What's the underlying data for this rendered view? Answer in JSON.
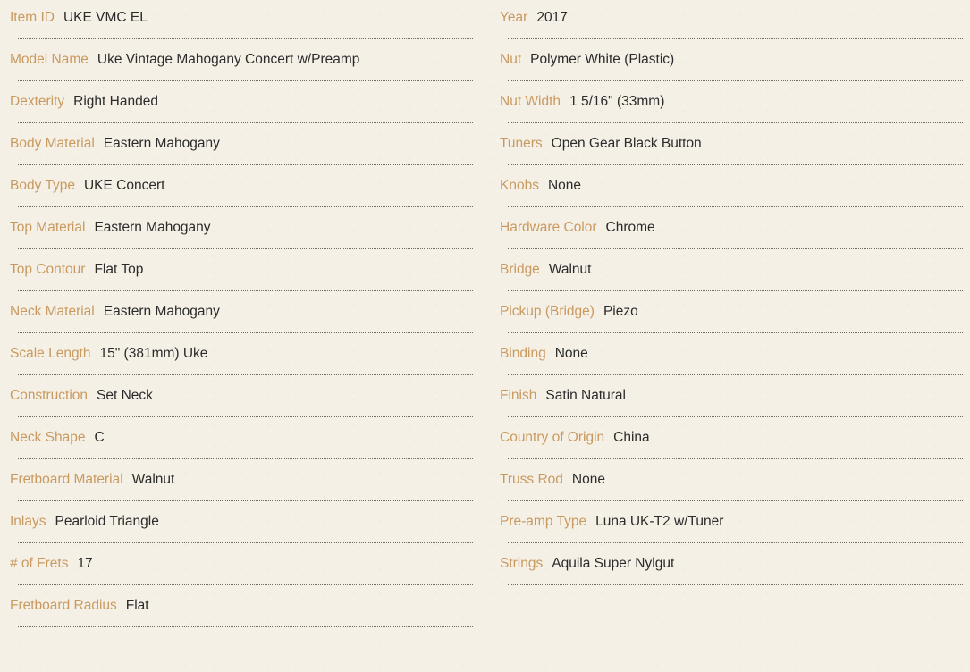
{
  "colors": {
    "background": "#f5f0e6",
    "label": "#c99a5f",
    "value": "#2b2b2b",
    "divider": "#6f6a62"
  },
  "left_column": [
    {
      "label": "Item ID",
      "value": "UKE VMC EL"
    },
    {
      "label": "Model Name",
      "value": "Uke Vintage Mahogany Concert w/Preamp"
    },
    {
      "label": "Dexterity",
      "value": "Right Handed"
    },
    {
      "label": "Body Material",
      "value": "Eastern Mahogany"
    },
    {
      "label": "Body Type",
      "value": "UKE Concert"
    },
    {
      "label": "Top Material",
      "value": "Eastern Mahogany"
    },
    {
      "label": "Top Contour",
      "value": "Flat Top"
    },
    {
      "label": "Neck Material",
      "value": "Eastern Mahogany"
    },
    {
      "label": "Scale Length",
      "value": "15\" (381mm) Uke"
    },
    {
      "label": "Construction",
      "value": "Set Neck"
    },
    {
      "label": "Neck Shape",
      "value": "C"
    },
    {
      "label": "Fretboard Material",
      "value": "Walnut"
    },
    {
      "label": "Inlays",
      "value": "Pearloid Triangle"
    },
    {
      "label": "# of Frets",
      "value": "17"
    },
    {
      "label": "Fretboard Radius",
      "value": "Flat"
    }
  ],
  "right_column": [
    {
      "label": "Year",
      "value": "2017"
    },
    {
      "label": "Nut",
      "value": "Polymer White (Plastic)"
    },
    {
      "label": "Nut Width",
      "value": "1 5/16\" (33mm)"
    },
    {
      "label": "Tuners",
      "value": "Open Gear Black Button"
    },
    {
      "label": "Knobs",
      "value": "None"
    },
    {
      "label": "Hardware Color",
      "value": "Chrome"
    },
    {
      "label": "Bridge",
      "value": "Walnut"
    },
    {
      "label": "Pickup (Bridge)",
      "value": "Piezo"
    },
    {
      "label": "Binding",
      "value": "None"
    },
    {
      "label": "Finish",
      "value": "Satin Natural"
    },
    {
      "label": "Country of Origin",
      "value": "China"
    },
    {
      "label": "Truss Rod",
      "value": "None"
    },
    {
      "label": "Pre-amp Type",
      "value": "Luna UK-T2 w/Tuner"
    },
    {
      "label": "Strings",
      "value": "Aquila Super Nylgut"
    }
  ]
}
